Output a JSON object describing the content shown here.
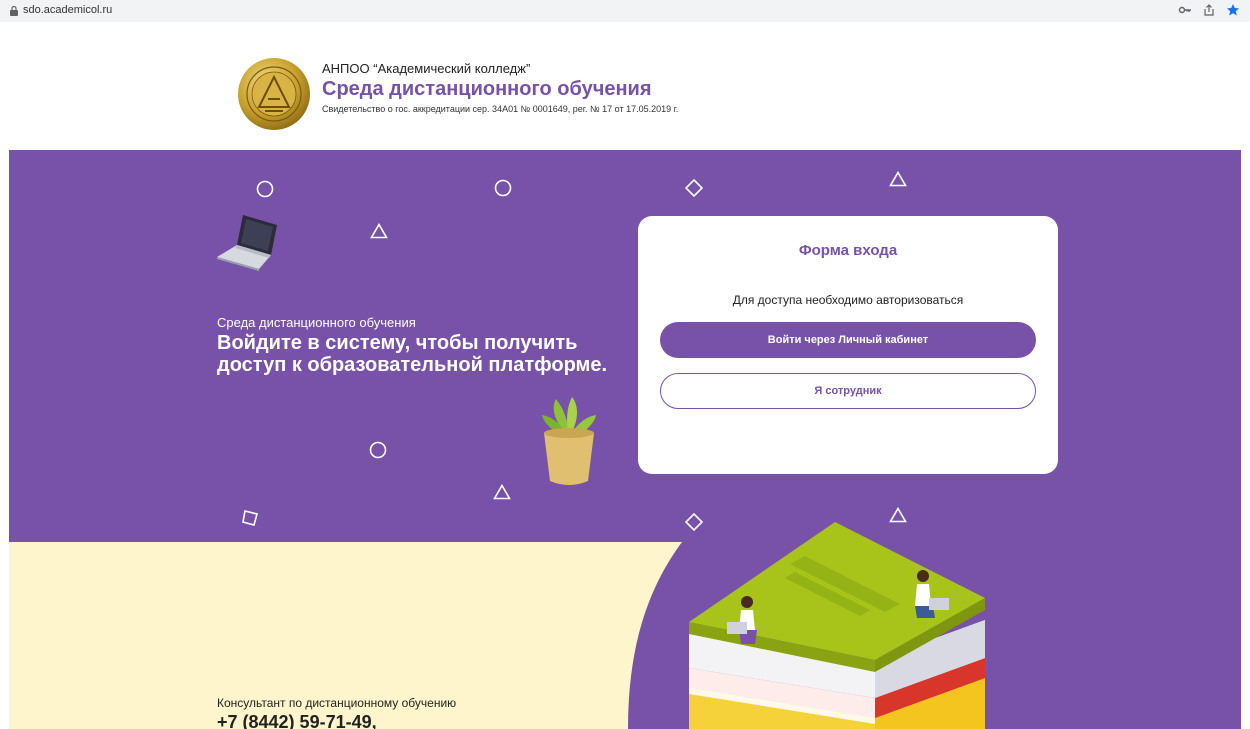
{
  "browser": {
    "url": "sdo.academicol.ru",
    "icons": [
      "lock-icon",
      "key-icon",
      "share-icon",
      "star-icon"
    ]
  },
  "header": {
    "org_name": "АНПОО “Академический колледж”",
    "site_title": "Среда дистанционного обучения",
    "accreditation": "Свидетельство о гос. аккредитации сер. 34А01 № 0001649, рег. № 17 от 17.05.2019 г.",
    "logo_text_top": "АКАДЕМИЧЕСКИЙ",
    "logo_text_bottom": "КОЛЛЕДЖ"
  },
  "hero": {
    "subtitle": "Среда дистанционного обучения",
    "title": "Войдите в систему, чтобы получить доступ к образовательной платформе."
  },
  "login": {
    "title": "Форма входа",
    "note": "Для доступа необходимо авторизоваться",
    "primary_button": "Войти через Личный кабинет",
    "secondary_button": "Я сотрудник"
  },
  "contact": {
    "label": "Консультант по дистанционному обучению",
    "phone": "+7 (8442) 59-71-49,"
  },
  "colors": {
    "brand": "#7752a8",
    "cream": "#fff5cc",
    "book_green": "#a8c41b"
  }
}
